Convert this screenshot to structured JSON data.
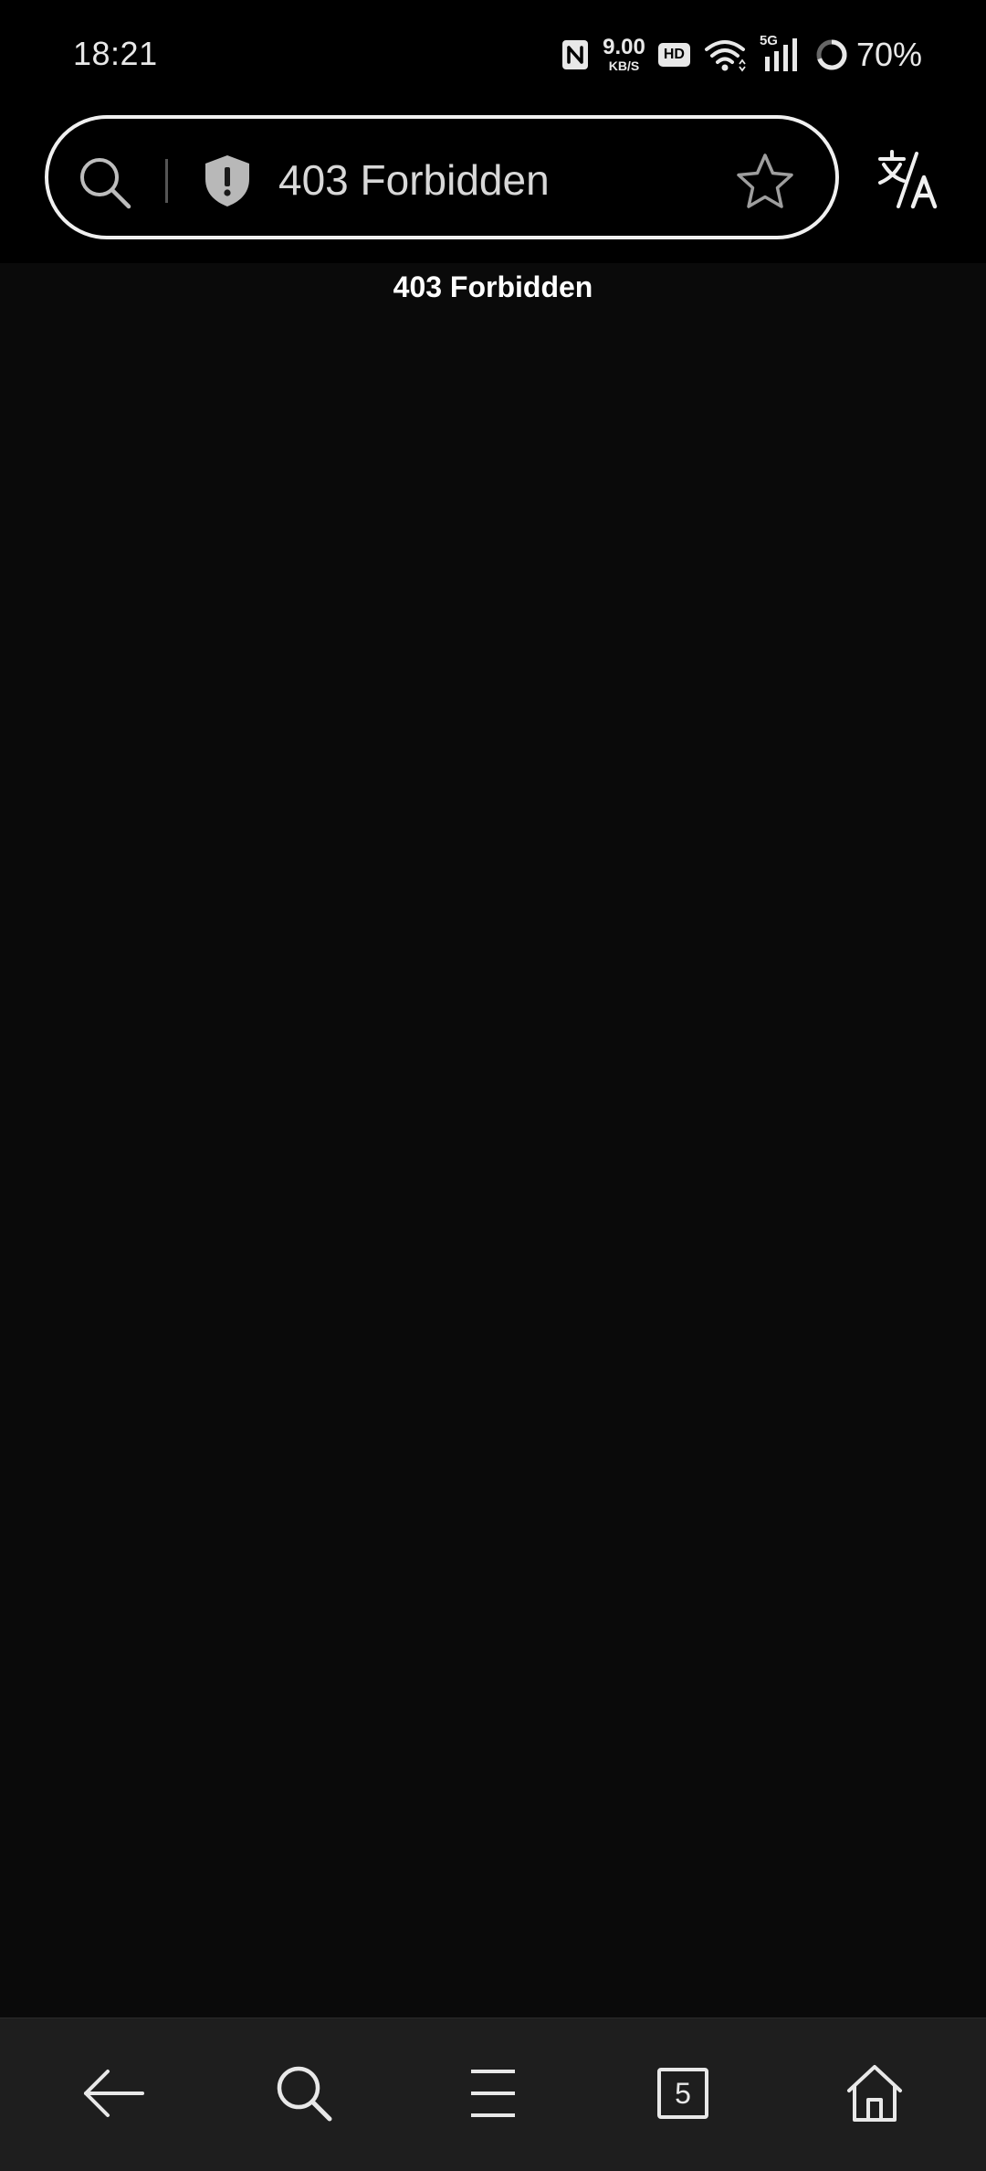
{
  "status_bar": {
    "time": "18:21",
    "net_speed_value": "9.00",
    "net_speed_unit": "KB/S",
    "hd_label": "HD",
    "network_label": "5G",
    "battery_percent": "70%"
  },
  "toolbar": {
    "url_text": "403 Forbidden",
    "icons": [
      "search-icon",
      "shield-warning-icon",
      "star-icon",
      "translate-icon"
    ]
  },
  "page": {
    "heading": "403 Forbidden"
  },
  "bottom_nav": {
    "tab_count": "5",
    "icons": [
      "back-arrow-icon",
      "search-icon",
      "menu-icon",
      "tabs-icon",
      "home-icon"
    ]
  },
  "colors": {
    "background": "#000000",
    "page_background": "#0a0a0a",
    "nav_background": "#1e1e1e",
    "foreground": "#e8e8e8"
  }
}
